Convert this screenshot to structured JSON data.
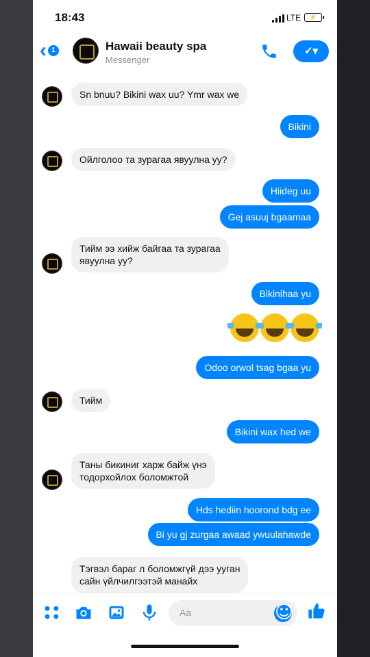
{
  "status_bar": {
    "time": "18:43",
    "network": "LTE",
    "battery_icon": "battery-charging-icon"
  },
  "header": {
    "back_badge": "1",
    "name": "Hawaii beauty spa",
    "subtitle": "Messenger",
    "accent": "#0084ff"
  },
  "messages": [
    {
      "side": "in",
      "text": "Sn bnuu? Bikini wax uu? Ymr wax we"
    },
    {
      "side": "out",
      "text": "Bikini"
    },
    {
      "side": "in",
      "text": "Ойлголоо та зурагаа явуулна уу?"
    },
    {
      "side": "out",
      "text": "Hiideg uu"
    },
    {
      "side": "out",
      "text": "Gej asuuj bgaamaa"
    },
    {
      "side": "in",
      "lines": [
        "Тийм ээ хийж байгаа та зурагаа",
        "явуулна уу?"
      ]
    },
    {
      "side": "out",
      "text": "Bikinihaa yu"
    },
    {
      "side": "out",
      "emoji": [
        "face-with-tears-of-joy-icon",
        "face-with-tears-of-joy-icon",
        "face-with-tears-of-joy-icon"
      ]
    },
    {
      "side": "out",
      "text": "Odoo orwol tsag bgaa yu"
    },
    {
      "side": "in",
      "text": "Тийм"
    },
    {
      "side": "out",
      "text": "Bikini wax hed we"
    },
    {
      "side": "in",
      "lines": [
        "Таны бикиниг харж байж үнэ",
        "тодорхойлох боломжтой"
      ]
    },
    {
      "side": "out",
      "text": "Hds hediin hoorond bdg ee"
    },
    {
      "side": "out",
      "text": "Bi yu gj zurgaa awaad ywuulahawde"
    },
    {
      "side": "in",
      "lines": [
        "Тэгвэл бараг л боломжгүй дээ ууган",
        "сайн үйлчилгээтэй манайх"
      ]
    }
  ],
  "composer": {
    "placeholder": "Aa",
    "icons": [
      "apps-icon",
      "camera-icon",
      "image-icon",
      "microphone-icon",
      "emoji-icon",
      "thumbs-up-icon"
    ]
  },
  "colors": {
    "outgoing": "#0084ff",
    "incoming": "#f0f0f0"
  }
}
